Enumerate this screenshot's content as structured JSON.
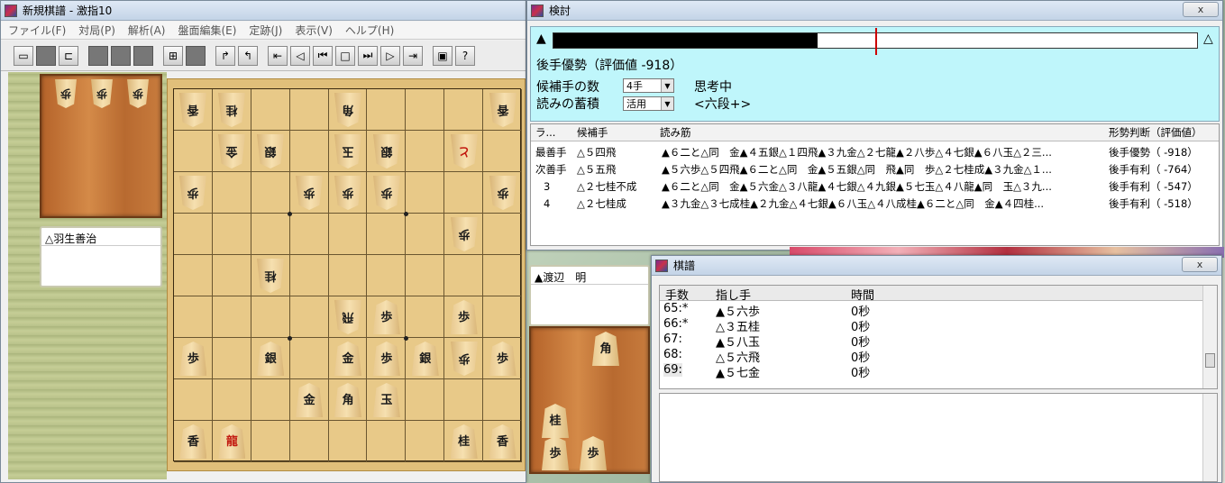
{
  "main_window": {
    "title": "新規棋譜 - 激指10",
    "menu": [
      "ファイル(F)",
      "対局(P)",
      "解析(A)",
      "盤面編集(E)",
      "定跡(J)",
      "表示(V)",
      "ヘルプ(H)"
    ],
    "gote_player": "△羽生善治",
    "gote_hand": [
      "歩",
      "歩",
      "歩"
    ]
  },
  "board": [
    {
      "col": 1,
      "row": 1,
      "p": "香",
      "side": "gote"
    },
    {
      "col": 2,
      "row": 1,
      "p": "桂",
      "side": "gote"
    },
    {
      "col": 5,
      "row": 1,
      "p": "角",
      "side": "gote"
    },
    {
      "col": 9,
      "row": 1,
      "p": "香",
      "side": "gote"
    },
    {
      "col": 2,
      "row": 2,
      "p": "金",
      "side": "gote"
    },
    {
      "col": 3,
      "row": 2,
      "p": "銀",
      "side": "gote"
    },
    {
      "col": 5,
      "row": 2,
      "p": "玉",
      "side": "gote"
    },
    {
      "col": 6,
      "row": 2,
      "p": "銀",
      "side": "gote"
    },
    {
      "col": 8,
      "row": 2,
      "p": "と",
      "side": "gote",
      "red": true
    },
    {
      "col": 1,
      "row": 3,
      "p": "歩",
      "side": "gote"
    },
    {
      "col": 4,
      "row": 3,
      "p": "歩",
      "side": "gote"
    },
    {
      "col": 5,
      "row": 3,
      "p": "歩",
      "side": "gote"
    },
    {
      "col": 6,
      "row": 3,
      "p": "歩",
      "side": "gote"
    },
    {
      "col": 9,
      "row": 3,
      "p": "歩",
      "side": "gote"
    },
    {
      "col": 8,
      "row": 4,
      "p": "歩",
      "side": "gote"
    },
    {
      "col": 3,
      "row": 5,
      "p": "桂",
      "side": "gote"
    },
    {
      "col": 5,
      "row": 6,
      "p": "飛",
      "side": "gote"
    },
    {
      "col": 6,
      "row": 6,
      "p": "歩",
      "side": "sente"
    },
    {
      "col": 8,
      "row": 6,
      "p": "歩",
      "side": "sente"
    },
    {
      "col": 1,
      "row": 7,
      "p": "歩",
      "side": "sente"
    },
    {
      "col": 3,
      "row": 7,
      "p": "銀",
      "side": "sente"
    },
    {
      "col": 5,
      "row": 7,
      "p": "金",
      "side": "sente"
    },
    {
      "col": 6,
      "row": 7,
      "p": "歩",
      "side": "sente"
    },
    {
      "col": 7,
      "row": 7,
      "p": "銀",
      "side": "sente"
    },
    {
      "col": 8,
      "row": 7,
      "p": "歩",
      "side": "gote"
    },
    {
      "col": 9,
      "row": 7,
      "p": "歩",
      "side": "sente"
    },
    {
      "col": 4,
      "row": 8,
      "p": "金",
      "side": "sente"
    },
    {
      "col": 5,
      "row": 8,
      "p": "角",
      "side": "sente"
    },
    {
      "col": 6,
      "row": 8,
      "p": "玉",
      "side": "sente"
    },
    {
      "col": 1,
      "row": 9,
      "p": "香",
      "side": "sente"
    },
    {
      "col": 2,
      "row": 9,
      "p": "龍",
      "side": "sente",
      "red": true
    },
    {
      "col": 8,
      "row": 9,
      "p": "桂",
      "side": "sente"
    },
    {
      "col": 9,
      "row": 9,
      "p": "香",
      "side": "sente"
    }
  ],
  "analysis": {
    "title": "検討",
    "close": "x",
    "sente_mark": "▲",
    "gote_mark": "△",
    "eval_fill": 0.41,
    "eval_marker": 0.5,
    "status": "後手優勢（評価値 -918）",
    "cand_count_label": "候補手の数",
    "cand_count": "4手",
    "thinking": "思考中",
    "accum_label": "読みの蓄積",
    "accum": "活用",
    "level": "<六段+>",
    "headers": [
      "ラ...",
      "候補手",
      "読み筋",
      "形勢判断（評価値）"
    ],
    "rows": [
      {
        "rank": "最善手",
        "move": "△５四飛",
        "line": "▲６二と△同　金▲４五銀△１四飛▲３九金△２七龍▲２八歩△４七銀▲６八玉△２三...",
        "eval": "後手優勢（  -918）"
      },
      {
        "rank": "次善手",
        "move": "△５五飛",
        "line": "▲５六歩△５四飛▲６二と△同　金▲５五銀△同　飛▲同　歩△２七桂成▲３九金△１...",
        "eval": "後手有利（  -764）"
      },
      {
        "rank": "3",
        "move": "△２七桂不成",
        "line": "▲６二と△同　金▲５六金△３八龍▲４七銀△４九銀▲５七玉△４八龍▲同　玉△３九...",
        "eval": "後手有利（  -547）"
      },
      {
        "rank": "4",
        "move": "△２七桂成",
        "line": "▲３九金△３七成桂▲２九金△４七銀▲６八玉△４八成桂▲６二と△同　金▲４四桂...",
        "eval": "後手有利（  -518）"
      }
    ]
  },
  "sente_player": "▲渡辺　明",
  "sente_hand": [
    "角",
    "桂",
    "歩",
    "歩"
  ],
  "kifu": {
    "title": "棋譜",
    "close": "x",
    "headers": [
      "手数",
      "指し手",
      "時間"
    ],
    "rows": [
      {
        "num": "65:*",
        "move": "▲５六歩",
        "time": "0秒"
      },
      {
        "num": "66:*",
        "move": "△３五桂",
        "time": "0秒"
      },
      {
        "num": "67:",
        "move": "▲５八玉",
        "time": "0秒"
      },
      {
        "num": "68:",
        "move": "△５六飛",
        "time": "0秒"
      },
      {
        "num": "69:",
        "move": "▲５七金",
        "time": "0秒"
      }
    ]
  }
}
